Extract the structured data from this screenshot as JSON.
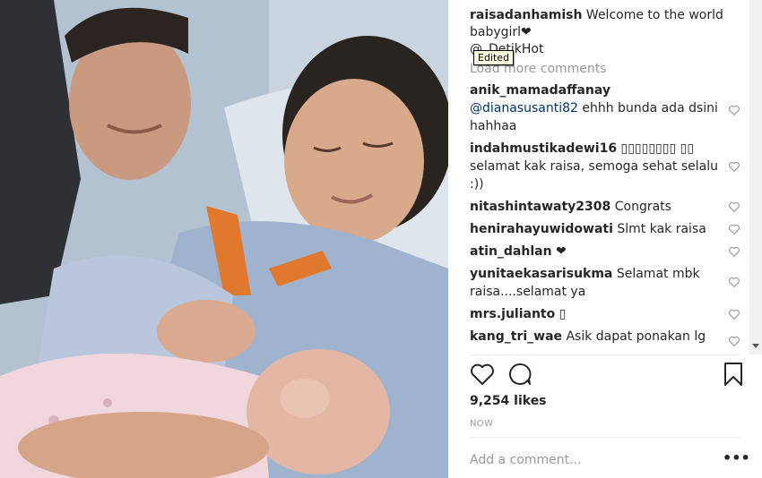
{
  "post": {
    "author": "raisadanhamish",
    "caption": "Welcome to the world babygirl❤",
    "credit": "@_DetikHot",
    "tooltip": "Edited",
    "load_more": "Load more comments"
  },
  "comments": [
    {
      "user": "anik_mamadaffanay",
      "mention": "@dianasusanti82",
      "text": " ehhh bunda ada dsini hahhaa"
    },
    {
      "user": "indahmustikadewi16",
      "mention": "",
      "text": " ▯▯▯▯▯▯▯▯ ▯▯ selamat kak raisa, semoga sehat selalu :))"
    },
    {
      "user": "nitashintawaty2308",
      "mention": "",
      "text": " Congrats"
    },
    {
      "user": "henirahayuwidowati",
      "mention": "",
      "text": " Slmt kak raisa"
    },
    {
      "user": "atin_dahlan",
      "mention": "",
      "text": " ❤"
    },
    {
      "user": "yunitaekasarisukma",
      "mention": "",
      "text": " Selamat mbk raisa....selamat ya"
    },
    {
      "user": "mrs.julianto",
      "mention": "",
      "text": " ▯"
    },
    {
      "user": "kang_tri_wae",
      "mention": "",
      "text": " Asik dapat ponakan lg"
    }
  ],
  "actions": {
    "like_icon": "heart-outline",
    "comment_icon": "speech-bubble",
    "save_icon": "bookmark-outline"
  },
  "likes": "9,254 likes",
  "timestamp": "NOW",
  "add_comment_placeholder": "Add a comment...",
  "more_label": "•••",
  "colors": {
    "text": "#262626",
    "muted": "#999999",
    "mention": "#003569",
    "divider": "#efefef"
  }
}
